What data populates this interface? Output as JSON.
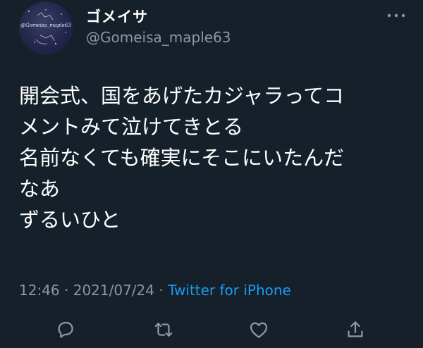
{
  "author": {
    "display_name": "ゴメイサ",
    "handle": "@Gomeisa_maple63",
    "avatar_text": "@Gomeisa_maple63"
  },
  "tweet": {
    "lines": [
      "開会式、国をあげたカジャラってコ",
      "メントみて泣けてきとる",
      "名前なくても確実にそこにいたんだ",
      "なあ",
      "ずるいひと"
    ]
  },
  "meta": {
    "time": "12:46",
    "separator": "·",
    "date": "2021/07/24",
    "source": "Twitter for iPhone"
  },
  "actions": [
    {
      "name": "reply-icon"
    },
    {
      "name": "retweet-icon"
    },
    {
      "name": "like-icon"
    },
    {
      "name": "share-icon"
    }
  ],
  "colors": {
    "background": "#15202b",
    "primary_text": "#ffffff",
    "secondary_text": "#8b98a5",
    "accent": "#1d9bf0"
  }
}
